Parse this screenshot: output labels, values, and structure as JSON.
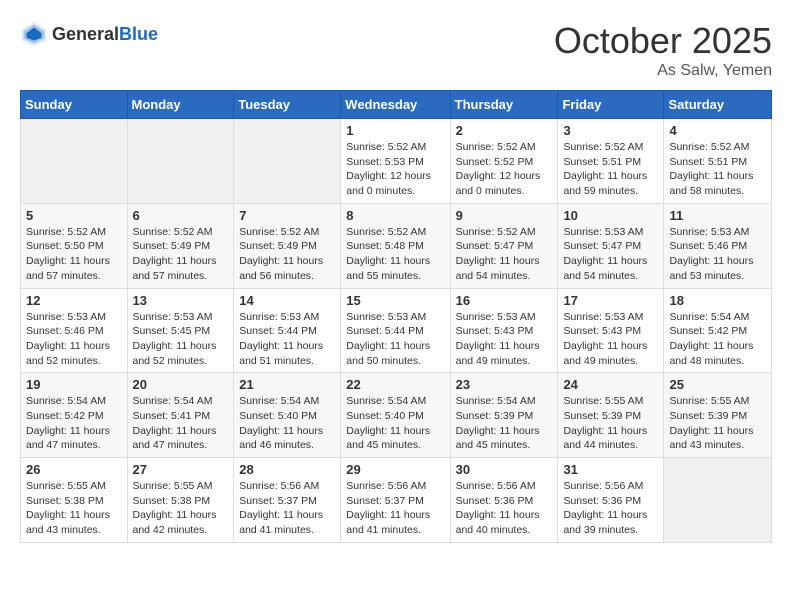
{
  "header": {
    "logo_general": "General",
    "logo_blue": "Blue",
    "month": "October 2025",
    "location": "As Salw, Yemen"
  },
  "weekdays": [
    "Sunday",
    "Monday",
    "Tuesday",
    "Wednesday",
    "Thursday",
    "Friday",
    "Saturday"
  ],
  "weeks": [
    [
      {
        "day": "",
        "info": ""
      },
      {
        "day": "",
        "info": ""
      },
      {
        "day": "",
        "info": ""
      },
      {
        "day": "1",
        "info": "Sunrise: 5:52 AM\nSunset: 5:53 PM\nDaylight: 12 hours\nand 0 minutes."
      },
      {
        "day": "2",
        "info": "Sunrise: 5:52 AM\nSunset: 5:52 PM\nDaylight: 12 hours\nand 0 minutes."
      },
      {
        "day": "3",
        "info": "Sunrise: 5:52 AM\nSunset: 5:51 PM\nDaylight: 11 hours\nand 59 minutes."
      },
      {
        "day": "4",
        "info": "Sunrise: 5:52 AM\nSunset: 5:51 PM\nDaylight: 11 hours\nand 58 minutes."
      }
    ],
    [
      {
        "day": "5",
        "info": "Sunrise: 5:52 AM\nSunset: 5:50 PM\nDaylight: 11 hours\nand 57 minutes."
      },
      {
        "day": "6",
        "info": "Sunrise: 5:52 AM\nSunset: 5:49 PM\nDaylight: 11 hours\nand 57 minutes."
      },
      {
        "day": "7",
        "info": "Sunrise: 5:52 AM\nSunset: 5:49 PM\nDaylight: 11 hours\nand 56 minutes."
      },
      {
        "day": "8",
        "info": "Sunrise: 5:52 AM\nSunset: 5:48 PM\nDaylight: 11 hours\nand 55 minutes."
      },
      {
        "day": "9",
        "info": "Sunrise: 5:52 AM\nSunset: 5:47 PM\nDaylight: 11 hours\nand 54 minutes."
      },
      {
        "day": "10",
        "info": "Sunrise: 5:53 AM\nSunset: 5:47 PM\nDaylight: 11 hours\nand 54 minutes."
      },
      {
        "day": "11",
        "info": "Sunrise: 5:53 AM\nSunset: 5:46 PM\nDaylight: 11 hours\nand 53 minutes."
      }
    ],
    [
      {
        "day": "12",
        "info": "Sunrise: 5:53 AM\nSunset: 5:46 PM\nDaylight: 11 hours\nand 52 minutes."
      },
      {
        "day": "13",
        "info": "Sunrise: 5:53 AM\nSunset: 5:45 PM\nDaylight: 11 hours\nand 52 minutes."
      },
      {
        "day": "14",
        "info": "Sunrise: 5:53 AM\nSunset: 5:44 PM\nDaylight: 11 hours\nand 51 minutes."
      },
      {
        "day": "15",
        "info": "Sunrise: 5:53 AM\nSunset: 5:44 PM\nDaylight: 11 hours\nand 50 minutes."
      },
      {
        "day": "16",
        "info": "Sunrise: 5:53 AM\nSunset: 5:43 PM\nDaylight: 11 hours\nand 49 minutes."
      },
      {
        "day": "17",
        "info": "Sunrise: 5:53 AM\nSunset: 5:43 PM\nDaylight: 11 hours\nand 49 minutes."
      },
      {
        "day": "18",
        "info": "Sunrise: 5:54 AM\nSunset: 5:42 PM\nDaylight: 11 hours\nand 48 minutes."
      }
    ],
    [
      {
        "day": "19",
        "info": "Sunrise: 5:54 AM\nSunset: 5:42 PM\nDaylight: 11 hours\nand 47 minutes."
      },
      {
        "day": "20",
        "info": "Sunrise: 5:54 AM\nSunset: 5:41 PM\nDaylight: 11 hours\nand 47 minutes."
      },
      {
        "day": "21",
        "info": "Sunrise: 5:54 AM\nSunset: 5:40 PM\nDaylight: 11 hours\nand 46 minutes."
      },
      {
        "day": "22",
        "info": "Sunrise: 5:54 AM\nSunset: 5:40 PM\nDaylight: 11 hours\nand 45 minutes."
      },
      {
        "day": "23",
        "info": "Sunrise: 5:54 AM\nSunset: 5:39 PM\nDaylight: 11 hours\nand 45 minutes."
      },
      {
        "day": "24",
        "info": "Sunrise: 5:55 AM\nSunset: 5:39 PM\nDaylight: 11 hours\nand 44 minutes."
      },
      {
        "day": "25",
        "info": "Sunrise: 5:55 AM\nSunset: 5:39 PM\nDaylight: 11 hours\nand 43 minutes."
      }
    ],
    [
      {
        "day": "26",
        "info": "Sunrise: 5:55 AM\nSunset: 5:38 PM\nDaylight: 11 hours\nand 43 minutes."
      },
      {
        "day": "27",
        "info": "Sunrise: 5:55 AM\nSunset: 5:38 PM\nDaylight: 11 hours\nand 42 minutes."
      },
      {
        "day": "28",
        "info": "Sunrise: 5:56 AM\nSunset: 5:37 PM\nDaylight: 11 hours\nand 41 minutes."
      },
      {
        "day": "29",
        "info": "Sunrise: 5:56 AM\nSunset: 5:37 PM\nDaylight: 11 hours\nand 41 minutes."
      },
      {
        "day": "30",
        "info": "Sunrise: 5:56 AM\nSunset: 5:36 PM\nDaylight: 11 hours\nand 40 minutes."
      },
      {
        "day": "31",
        "info": "Sunrise: 5:56 AM\nSunset: 5:36 PM\nDaylight: 11 hours\nand 39 minutes."
      },
      {
        "day": "",
        "info": ""
      }
    ]
  ]
}
